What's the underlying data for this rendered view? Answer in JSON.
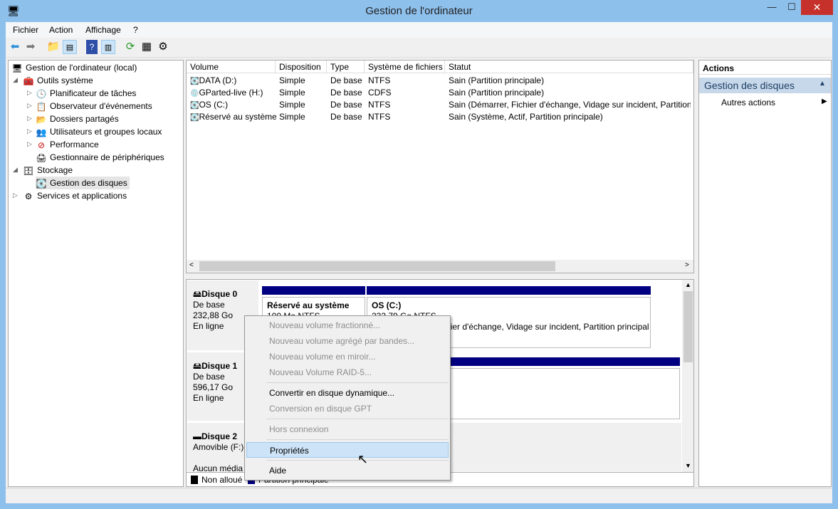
{
  "window": {
    "title": "Gestion de l'ordinateur",
    "close": "✕",
    "minimize": "—",
    "maximize": "☐"
  },
  "menubar": [
    "Fichier",
    "Action",
    "Affichage",
    "?"
  ],
  "toolbar": [
    "back-icon",
    "forward-icon",
    "up-folder-icon",
    "show-hide-tree-icon",
    "help-icon",
    "show-hide-action-pane-icon",
    "refresh-icon",
    "properties-icon",
    "settings-icon"
  ],
  "tree": {
    "root": "Gestion de l'ordinateur (local)",
    "items": [
      {
        "label": "Outils système",
        "level": 1
      },
      {
        "label": "Planificateur de tâches",
        "level": 2
      },
      {
        "label": "Observateur d'événements",
        "level": 2
      },
      {
        "label": "Dossiers partagés",
        "level": 2
      },
      {
        "label": "Utilisateurs et groupes locaux",
        "level": 2
      },
      {
        "label": "Performance",
        "level": 2
      },
      {
        "label": "Gestionnaire de périphériques",
        "level": 2
      },
      {
        "label": "Stockage",
        "level": 1
      },
      {
        "label": "Gestion des disques",
        "level": 2
      },
      {
        "label": "Services et applications",
        "level": 1
      }
    ]
  },
  "volumes": {
    "headers": [
      "Volume",
      "Disposition",
      "Type",
      "Système de fichiers",
      "Statut"
    ],
    "rows": [
      [
        "DATA (D:)",
        "Simple",
        "De base",
        "NTFS",
        "Sain (Partition principale)"
      ],
      [
        "GParted-live (H:)",
        "Simple",
        "De base",
        "CDFS",
        "Sain (Partition principale)"
      ],
      [
        "OS (C:)",
        "Simple",
        "De base",
        "NTFS",
        "Sain (Démarrer, Fichier d'échange, Vidage sur incident, Partition p"
      ],
      [
        "Réservé au système",
        "Simple",
        "De base",
        "NTFS",
        "Sain (Système, Actif, Partition principale)"
      ]
    ]
  },
  "disks": [
    {
      "name": "Disque 0",
      "type": "De base",
      "size": "232,88 Go",
      "state": "En ligne",
      "parts": [
        {
          "name": "Réservé au système",
          "info": "100 Mo NTFS"
        },
        {
          "name": "OS  (C:)",
          "info": "232,79 Go NTFS",
          "status": "Sain (Démarrer, Fichier d'échange, Vidage sur incident, Partition principal"
        }
      ]
    },
    {
      "name": "Disque 1",
      "type": "De base",
      "size": "596,17 Go",
      "state": "En ligne"
    },
    {
      "name": "Disque 2",
      "type": "Amovible (F:)",
      "state": "Aucun média"
    }
  ],
  "legend": [
    "Non alloué",
    "Partition principale"
  ],
  "actions": {
    "header": "Actions",
    "section": "Gestion des disques",
    "item": "Autres actions"
  },
  "context_menu": [
    {
      "label": "Nouveau volume fractionné...",
      "enabled": false
    },
    {
      "label": "Nouveau volume agrégé par bandes...",
      "enabled": false
    },
    {
      "label": "Nouveau volume en miroir...",
      "enabled": false
    },
    {
      "label": "Nouveau Volume RAID-5...",
      "enabled": false
    },
    {
      "label": "Convertir en disque dynamique...",
      "enabled": true
    },
    {
      "label": "Conversion en disque GPT",
      "enabled": false
    },
    {
      "label": "Hors connexion",
      "enabled": false
    },
    {
      "label": "Propriétés",
      "enabled": true,
      "highlighted": true
    },
    {
      "label": "Aide",
      "enabled": true
    }
  ],
  "colors": {
    "partition_bar": "#000080",
    "highlight": "#cde3f7",
    "close": "#c7312b"
  }
}
